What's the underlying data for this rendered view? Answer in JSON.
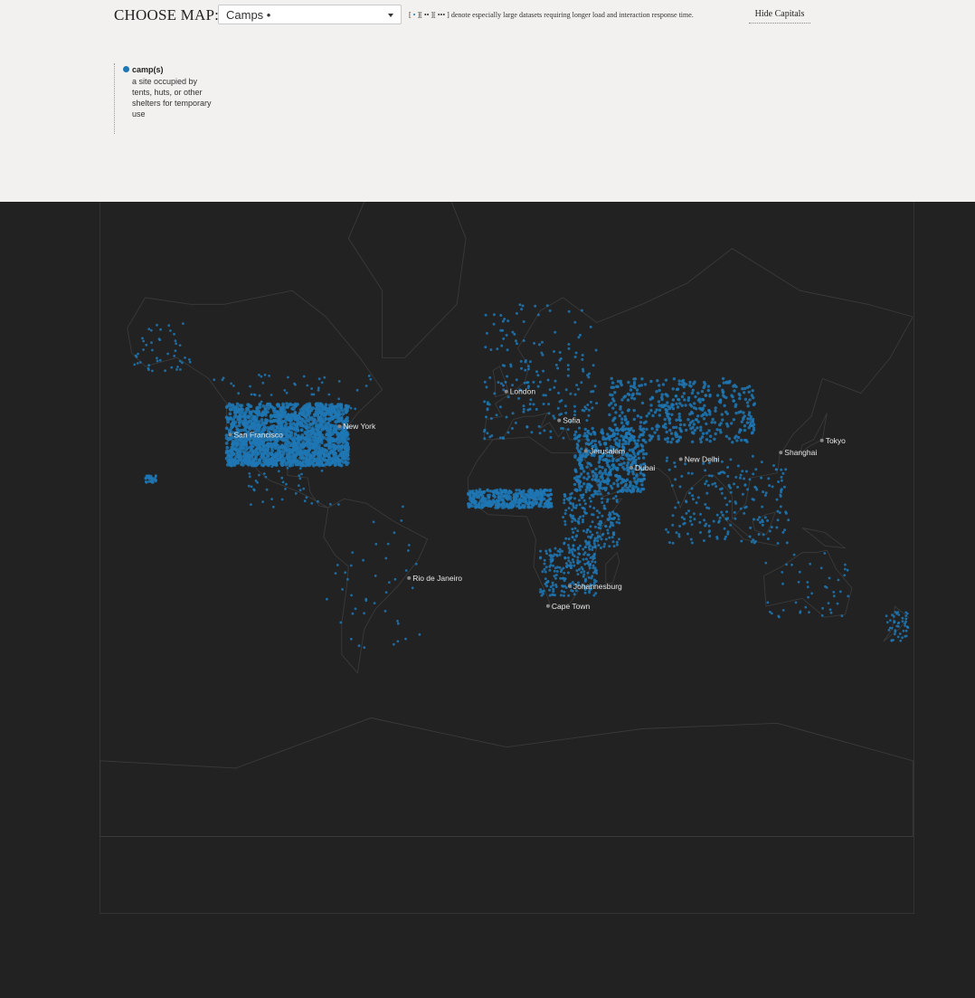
{
  "header": {
    "choose_label": "CHOOSE MAP:",
    "selected_map": "Camps •",
    "note_open": "[ ",
    "note_dot1": "•",
    "note_mid1": " ][ ",
    "note_dot2": "••",
    "note_mid2": " ][ ",
    "note_dot3": "•••",
    "note_rest": " ] denote especially large datasets requiring longer load and interaction response time.",
    "hide_capitals": "Hide Capitals"
  },
  "legend": {
    "title": "camp(s)",
    "description": "a site occupied by tents, huts, or other shelters for temporary use"
  },
  "colors": {
    "points": "#1f77b4",
    "background": "#222222",
    "land_outline": "#3a3a3a",
    "city_dot": "#888888"
  },
  "cities": [
    {
      "name": "London",
      "lon": -0.13,
      "lat": 51.5
    },
    {
      "name": "Sofia",
      "lon": 23.32,
      "lat": 42.7
    },
    {
      "name": "Jerusalem",
      "lon": 35.2,
      "lat": 31.8
    },
    {
      "name": "Dubai",
      "lon": 55.3,
      "lat": 25.2
    },
    {
      "name": "New Delhi",
      "lon": 77.2,
      "lat": 28.6
    },
    {
      "name": "Shanghai",
      "lon": 121.5,
      "lat": 31.2
    },
    {
      "name": "Tokyo",
      "lon": 139.7,
      "lat": 35.7
    },
    {
      "name": "New York",
      "lon": -74.0,
      "lat": 40.7
    },
    {
      "name": "San Francisco",
      "lon": -122.4,
      "lat": 37.8
    },
    {
      "name": "Rio de Janeiro",
      "lon": -43.2,
      "lat": -22.9
    },
    {
      "name": "Johannesburg",
      "lon": 28.0,
      "lat": -26.2
    },
    {
      "name": "Cape Town",
      "lon": 18.4,
      "lat": -33.9
    }
  ],
  "point_clusters": [
    {
      "region": "United States",
      "lon": [
        -124,
        -70
      ],
      "lat": [
        26,
        48
      ],
      "density": "very-high"
    },
    {
      "region": "Alaska",
      "lon": [
        -165,
        -140
      ],
      "lat": [
        56,
        68
      ],
      "density": "low"
    },
    {
      "region": "Canada",
      "lon": [
        -130,
        -60
      ],
      "lat": [
        46,
        56
      ],
      "density": "low"
    },
    {
      "region": "Hawaii",
      "lon": [
        -160,
        -155
      ],
      "lat": [
        19,
        22
      ],
      "density": "low"
    },
    {
      "region": "Mexico & Central America",
      "lon": [
        -115,
        -78
      ],
      "lat": [
        8,
        30
      ],
      "density": "low"
    },
    {
      "region": "South America",
      "lon": [
        -80,
        -38
      ],
      "lat": [
        -50,
        10
      ],
      "density": "low"
    },
    {
      "region": "Europe",
      "lon": [
        -10,
        40
      ],
      "lat": [
        36,
        70
      ],
      "density": "medium"
    },
    {
      "region": "Middle East",
      "lon": [
        30,
        62
      ],
      "lat": [
        15,
        40
      ],
      "density": "high"
    },
    {
      "region": "Central Asia",
      "lon": [
        45,
        110
      ],
      "lat": [
        35,
        55
      ],
      "density": "high"
    },
    {
      "region": "Sahel",
      "lon": [
        -17,
        20
      ],
      "lat": [
        8,
        16
      ],
      "density": "high"
    },
    {
      "region": "East Africa",
      "lon": [
        25,
        50
      ],
      "lat": [
        -10,
        15
      ],
      "density": "medium"
    },
    {
      "region": "Southern Africa",
      "lon": [
        15,
        40
      ],
      "lat": [
        -30,
        -10
      ],
      "density": "medium"
    },
    {
      "region": "South & SE Asia",
      "lon": [
        70,
        125
      ],
      "lat": [
        -8,
        30
      ],
      "density": "medium"
    },
    {
      "region": "Australia",
      "lon": [
        113,
        153
      ],
      "lat": [
        -38,
        -12
      ],
      "density": "low"
    },
    {
      "region": "New Zealand",
      "lon": [
        168,
        178
      ],
      "lat": [
        -46,
        -36
      ],
      "density": "low"
    }
  ]
}
